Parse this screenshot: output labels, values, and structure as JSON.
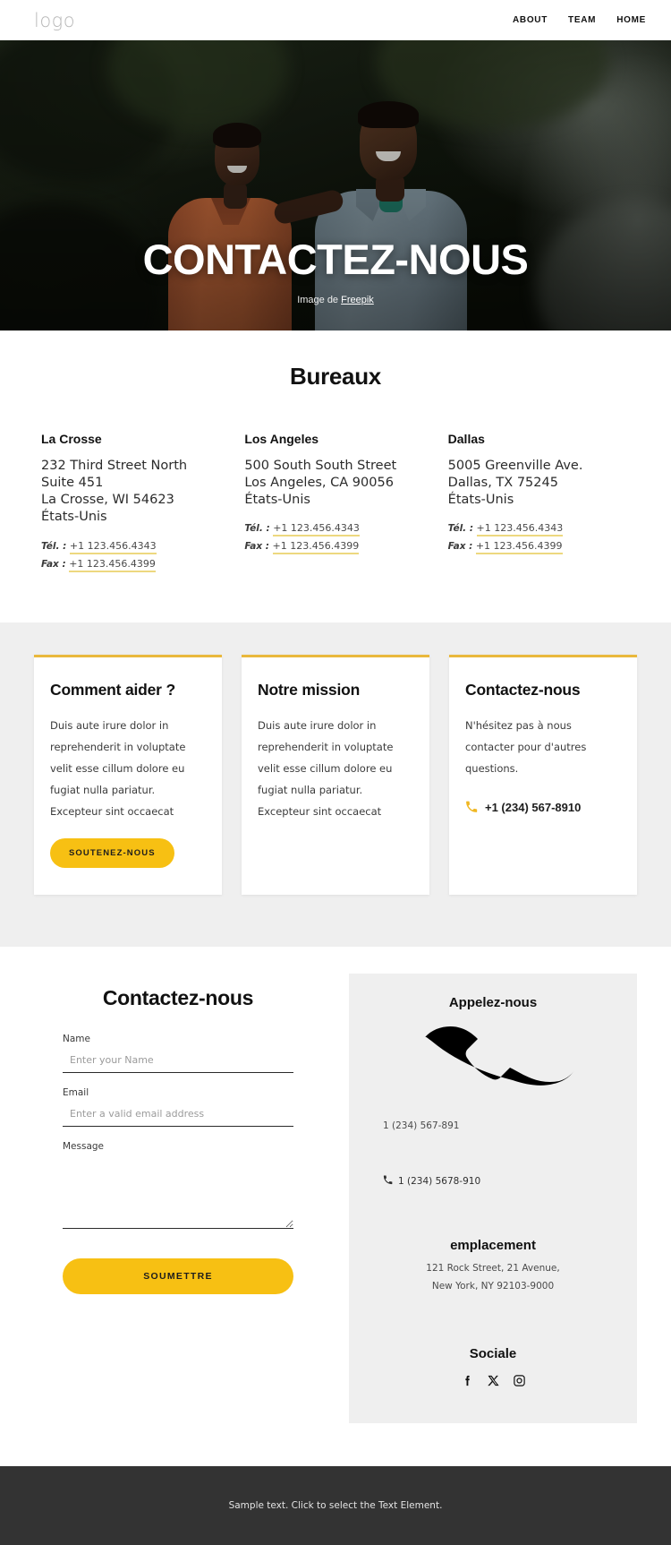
{
  "header": {
    "logo": "logo",
    "nav": [
      {
        "label": "ABOUT"
      },
      {
        "label": "TEAM"
      },
      {
        "label": "HOME"
      }
    ]
  },
  "hero": {
    "title": "CONTACTEZ-NOUS",
    "caption_prefix": "Image de ",
    "caption_link": "Freepik"
  },
  "offices": {
    "title": "Bureaux",
    "items": [
      {
        "name": "La Crosse",
        "address": "232 Third Street North Suite 451\nLa Crosse, WI 54623\nÉtats-Unis",
        "tel_label": "Tél. :",
        "tel": "+1 123.456.4343",
        "fax_label": "Fax :",
        "fax": "+1 123.456.4399"
      },
      {
        "name": "Los Angeles",
        "address": "500 South South Street\nLos Angeles, CA 90056\nÉtats-Unis",
        "tel_label": "Tél. :",
        "tel": "+1 123.456.4343",
        "fax_label": "Fax :",
        "fax": "+1 123.456.4399"
      },
      {
        "name": "Dallas",
        "address": "5005 Greenville Ave.\nDallas, TX 75245\nÉtats-Unis",
        "tel_label": "Tél. :",
        "tel": "+1 123.456.4343",
        "fax_label": "Fax :",
        "fax": "+1 123.456.4399"
      }
    ]
  },
  "cards": [
    {
      "title": "Comment aider ?",
      "text": "Duis aute irure dolor in reprehenderit in voluptate velit esse cillum dolore eu fugiat nulla pariatur. Excepteur sint occaecat",
      "button": "SOUTENEZ-NOUS"
    },
    {
      "title": "Notre mission",
      "text": "Duis aute irure dolor in reprehenderit in voluptate velit esse cillum dolore eu fugiat nulla pariatur. Excepteur sint occaecat"
    },
    {
      "title": "Contactez-nous",
      "text": "N'hésitez pas à nous contacter pour d'autres questions.",
      "phone": "+1 (234) 567-8910"
    }
  ],
  "contact": {
    "form_title": "Contactez-nous",
    "name_label": "Name",
    "name_placeholder": "Enter your Name",
    "name_value": "",
    "email_label": "Email",
    "email_placeholder": "Enter a valid email address",
    "email_value": "",
    "message_label": "Message",
    "message_placeholder": "",
    "message_value": "",
    "submit_label": "SOUMETTRE"
  },
  "info": {
    "call_title": "Appelez-nous",
    "phone_primary": "1 (234) 567-891",
    "phone_secondary": "1 (234) 5678-910",
    "location_title": "emplacement",
    "location_line1": "121 Rock Street, 21 Avenue,",
    "location_line2": "New York, NY 92103-9000",
    "social_title": "Sociale",
    "socials": [
      {
        "name": "facebook-icon"
      },
      {
        "name": "x-icon"
      },
      {
        "name": "instagram-icon"
      }
    ]
  },
  "footer": {
    "text": "Sample text. Click to select the Text Element."
  },
  "colors": {
    "accent": "#f7c013",
    "card_border": "#e9b83c",
    "underline": "#edd87f",
    "panel_bg": "#efefef",
    "footer_bg": "#333333"
  }
}
